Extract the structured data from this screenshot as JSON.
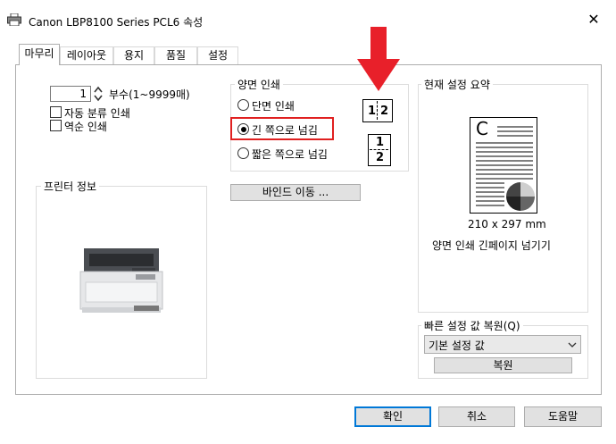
{
  "window": {
    "title": "Canon LBP8100 Series PCL6 속성",
    "close_glyph": "✕"
  },
  "tabs": [
    {
      "label": "마무리"
    },
    {
      "label": "레이아웃"
    },
    {
      "label": "용지"
    },
    {
      "label": "품질"
    },
    {
      "label": "설정"
    }
  ],
  "copies": {
    "value": "1",
    "label": "부수(1~9999매)"
  },
  "options": {
    "collate_label": "자동 분류 인쇄",
    "reverse_label": "역순 인쇄"
  },
  "printer_info": {
    "title": "프린터 정보"
  },
  "duplex": {
    "title": "양면 인쇄",
    "options": [
      {
        "label": "단면 인쇄",
        "selected": false
      },
      {
        "label": "긴 쪽으로 넘김",
        "selected": true
      },
      {
        "label": "짧은 쪽으로 넘김",
        "selected": false
      }
    ],
    "icon_long": {
      "a": "1",
      "b": "2"
    },
    "icon_short": {
      "a": "1",
      "b": "2"
    },
    "binding_button": "바인드 이동 ..."
  },
  "summary": {
    "title": "현재 설정 요약",
    "color_mark": "C",
    "paper_size": "210 x 297 mm",
    "description": "양면 인쇄 긴페이지 넘기기"
  },
  "quick_settings": {
    "title": "빠른 설정 값 복원(Q)",
    "selected": "기본 설정 값",
    "restore_button": "복원"
  },
  "footer": {
    "ok": "확인",
    "cancel": "취소",
    "help": "도움말"
  },
  "colors": {
    "highlight_red": "#e02020",
    "arrow_red": "#e8202a",
    "focus_blue": "#0078d7"
  }
}
